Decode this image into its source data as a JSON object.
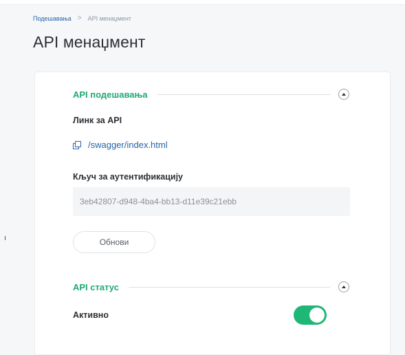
{
  "breadcrumb": {
    "parent": "Подешавања",
    "separator": ">",
    "current": "API менаџмент"
  },
  "page": {
    "title": "API менаџмент"
  },
  "api_settings": {
    "section_title": "API подешавања",
    "link_label": "Линк за API",
    "link_text": "/swagger/index.html",
    "key_label": "Кључ за аутентификацију",
    "key_value": "3eb42807-d948-4ba4-bb13-d11e39c21ebb",
    "refresh_label": "Обнови"
  },
  "api_status": {
    "section_title": "API статус",
    "active_label": "Активно",
    "active": true
  },
  "colors": {
    "accent_green": "#1fb775",
    "link_blue": "#2563a8"
  },
  "icons": {
    "copy": "copy-icon",
    "collapse": "chevron-up-icon"
  }
}
